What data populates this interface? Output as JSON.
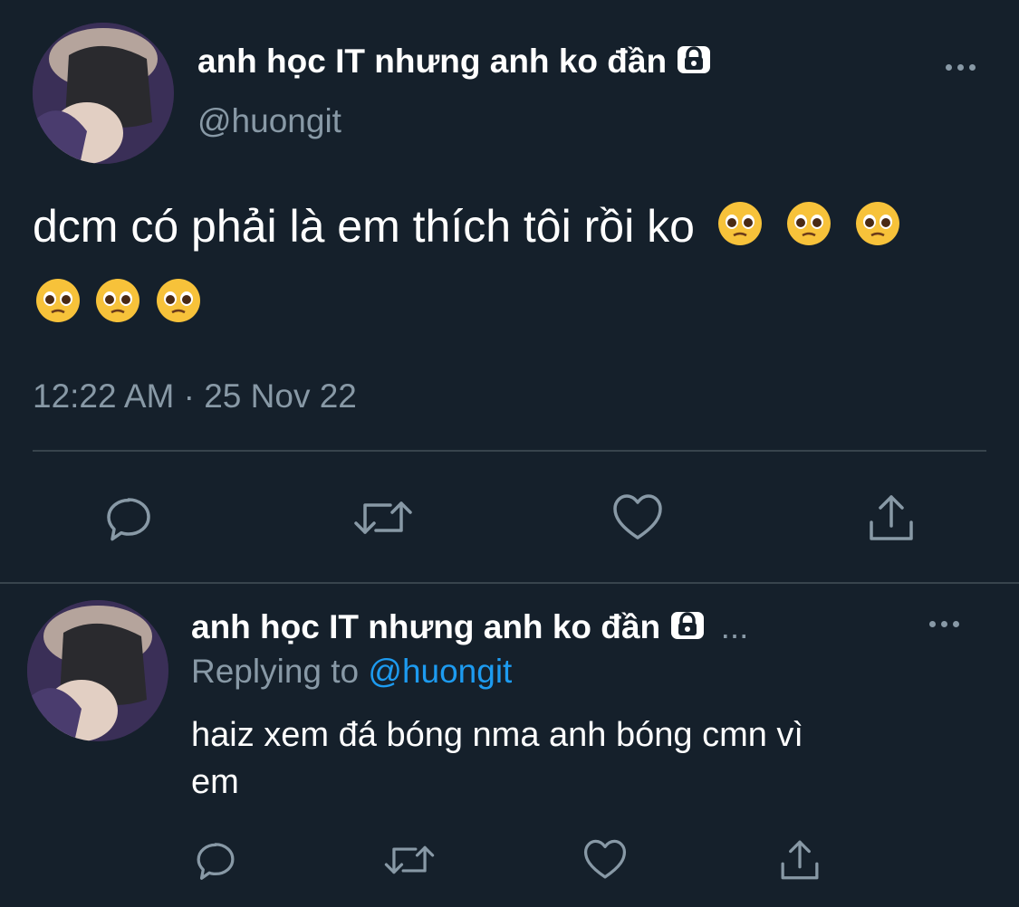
{
  "main_tweet": {
    "display_name": "anh học IT nhưng anh ko đần",
    "handle": "@huongit",
    "text_line1": "dcm có phải là em thích tôi rồi ko",
    "emoji": "🥺",
    "timestamp": "12:22 AM · 25 Nov 22",
    "icons": {
      "protected": "lock-icon",
      "more": "more-icon",
      "reply": "reply-icon",
      "retweet": "retweet-icon",
      "like": "heart-icon",
      "share": "share-icon"
    }
  },
  "reply_tweet": {
    "display_name": "anh học IT nhưng anh ko đần",
    "ellipsis": "...",
    "replying_prefix": "Replying to",
    "replying_handle": "@huongit",
    "text_line1": "haiz xem đá bóng nma anh bóng cmn vì",
    "text_line2": "em"
  },
  "colors": {
    "background": "#15202b",
    "text": "#ffffff",
    "muted": "#8899a6",
    "link": "#1d9bf0",
    "divider": "#38444d"
  }
}
